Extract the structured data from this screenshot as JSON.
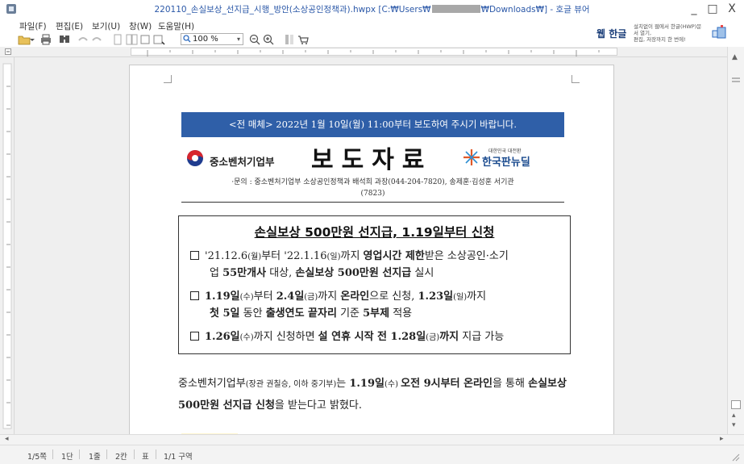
{
  "window": {
    "title_prefix": "220110_손실보상_선지급_시행_방안(소상공인정책과).hwpx [C:₩Users₩",
    "title_suffix": "₩Downloads₩] - 호글 뷰어",
    "controls": [
      "_",
      "□",
      "X"
    ]
  },
  "menu": [
    {
      "label": "파일(F)"
    },
    {
      "label": "편집(E)"
    },
    {
      "label": "보기(U)"
    },
    {
      "label": "창(W)"
    },
    {
      "label": "도움말(H)"
    }
  ],
  "toolbar": {
    "zoom_value": "100 %",
    "icons": [
      "open-icon",
      "print-icon",
      "find-icon",
      "undo-icon",
      "redo-icon",
      "page-view-icon",
      "zoom-out-icon",
      "zoom-in-icon",
      "layout-icon",
      "cart-icon"
    ]
  },
  "brand": {
    "logo": "웹 한글",
    "promo_line1": "설치없이 웹에서 한글(HWP)문서 열기,",
    "promo_line2": "편집, 저장까지 한 번에!"
  },
  "document": {
    "embargo": "<전 매체> 2022년 1월 10일(월) 11:00부터 보도하여 주시기 바랍니다.",
    "ministry": "중소벤처기업부",
    "press_title": "보도자료",
    "knd_small": "대한민국 대전환",
    "knd_name": "한국판뉴딜",
    "contact_line1": "·문의 : 중소벤처기업부 소상공인정책과 배석희 과장(044-204-7820), 송제훈·김성훈 서기관",
    "contact_line2": "(7823)",
    "headline": "손실보상 500만원 선지급, 1.19일부터 신청",
    "bullets": [
      {
        "p1": "'21.12.6",
        "p2": "(월)",
        "p3": "부터 '22.1.16",
        "p4": "(일)",
        "p5": "까지 ",
        "b1": "영업시간 제한",
        "p6": "받은 소상공인·소기",
        "l2a": "업 ",
        "b2": "55만개사",
        "l2b": " 대상, ",
        "b3": "손실보상 500만원 선지급",
        "l2c": " 실시"
      },
      {
        "b1": "1.19일",
        "p1": "(수)",
        "p2": "부터 ",
        "b2": "2.4일",
        "p3": "(금)",
        "p4": "까지 ",
        "b3": "온라인",
        "p5": "으로 신청, ",
        "b4": "1.23일",
        "p6": "(일)",
        "p7": "까지",
        "b5": "첫 5일",
        "l2a": " 동안 ",
        "b6": "출생연도 끝자리",
        "l2b": " 기준 ",
        "b7": "5부제",
        "l2c": " 적용"
      },
      {
        "b1": "1.26일",
        "p1": "(수)",
        "p2": "까지 신청하면 ",
        "b2": "설 연휴 시작 전 1.28일",
        "p3": "(금)",
        "b3": "까지",
        "p4": " 지급 가능"
      }
    ],
    "body_p1": "중소벤처기업부",
    "body_p2": "(장관 권칠승, 이하 중기부)",
    "body_p3": "는 ",
    "body_b1": "1.19일",
    "body_p4": "(수) ",
    "body_b2": "오전 9시부터 온라인",
    "body_p5": "을 통해 ",
    "body_b3": "손실보상 500만원 선지급 신청",
    "body_p6": "을 받는다고 밝혔다."
  },
  "status": {
    "page": "1/5쪽",
    "section": "1단",
    "line": "1줄",
    "column": "2칸",
    "mode": "표",
    "area": "1/1 구역"
  }
}
